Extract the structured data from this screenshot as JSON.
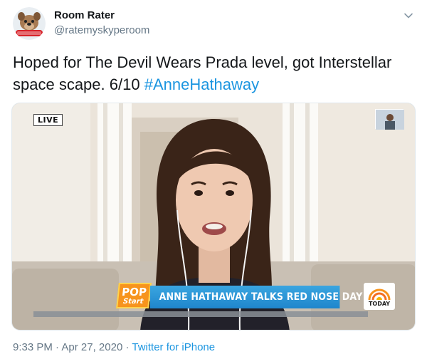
{
  "author": {
    "display_name": "Room Rater",
    "handle": "@ratemyskyperoom",
    "avatar_icon": "mad-dog-pac-dog-avatar"
  },
  "tweet": {
    "text": "Hoped for The Devil Wears Prada level, got Interstellar space scape. 6/10",
    "hashtag": "#AnneHathaway"
  },
  "media": {
    "live_label": "LIVE",
    "lower_third": {
      "logo_top": "POP",
      "logo_bottom": "Start",
      "headline": "ANNE HATHAWAY TALKS RED NOSE DAY"
    },
    "network_logo": "TODAY"
  },
  "meta": {
    "time": "9:33 PM",
    "separator": "·",
    "date": "Apr 27, 2020",
    "source": "Twitter for iPhone"
  },
  "colors": {
    "link": "#1b95e0",
    "secondary_text": "#657786",
    "banner_blue": "#1f86cc"
  }
}
